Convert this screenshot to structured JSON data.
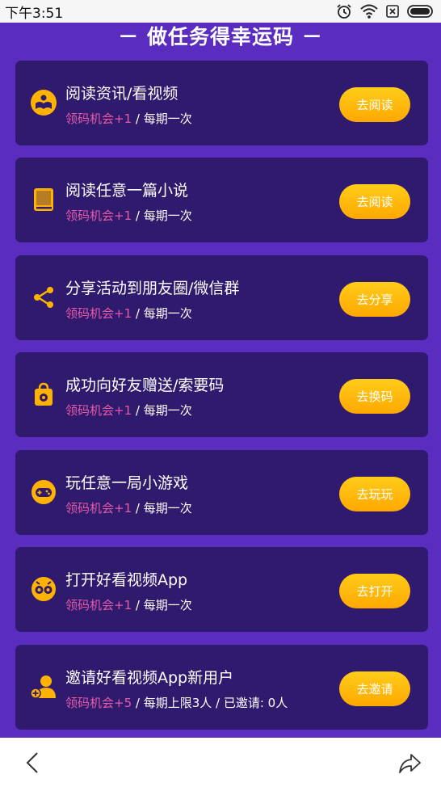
{
  "status_bar": {
    "time": "下午3:51"
  },
  "page": {
    "title": "－ 做任务得幸运码 －"
  },
  "tasks": [
    {
      "title": "阅读资讯/看视频",
      "reward": "领码机会+1",
      "detail": " / 每期一次",
      "button": "去阅读",
      "icon": "read-news-icon"
    },
    {
      "title": "阅读任意一篇小说",
      "reward": "领码机会+1",
      "detail": " / 每期一次",
      "button": "去阅读",
      "icon": "book-icon"
    },
    {
      "title": "分享活动到朋友圈/微信群",
      "reward": "领码机会+1",
      "detail": " / 每期一次",
      "button": "去分享",
      "icon": "share-icon"
    },
    {
      "title": "成功向好友赠送/索要码",
      "reward": "领码机会+1",
      "detail": " / 每期一次",
      "button": "去换码",
      "icon": "gift-bag-icon"
    },
    {
      "title": "玩任意一局小游戏",
      "reward": "领码机会+1",
      "detail": " / 每期一次",
      "button": "去玩玩",
      "icon": "game-controller-icon"
    },
    {
      "title": "打开好看视频App",
      "reward": "领码机会+1",
      "detail": " / 每期一次",
      "button": "去打开",
      "icon": "video-app-icon"
    },
    {
      "title": "邀请好看视频App新用户",
      "reward": "领码机会+5",
      "detail": " / 每期上限3人 / 已邀请: 0人",
      "button": "去邀请",
      "icon": "add-user-icon"
    }
  ],
  "colors": {
    "background": "#5a2cbf",
    "card": "#2f1a6e",
    "reward": "#e85aa8",
    "button": "#ffb300",
    "icon": "#ffb300"
  }
}
